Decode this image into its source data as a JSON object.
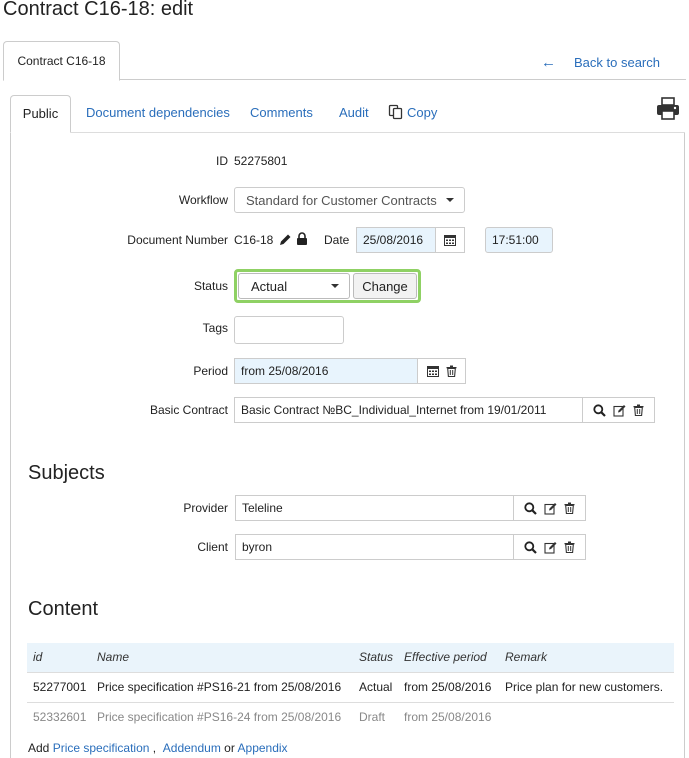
{
  "page_title": "Contract C16-18: edit",
  "outer_tab": "Contract C16-18",
  "back_link": "Back to search",
  "inner_tabs": [
    {
      "label": "Public"
    },
    {
      "label": "Document dependencies"
    },
    {
      "label": "Comments"
    },
    {
      "label": "Audit"
    },
    {
      "label": "Copy"
    }
  ],
  "form": {
    "id_label": "ID",
    "id_value": "52275801",
    "workflow_label": "Workflow",
    "workflow_value": "Standard for Customer Contracts",
    "docnum_label": "Document Number",
    "docnum_value": "C16-18",
    "date_label": "Date",
    "date_value": "25/08/2016",
    "time_value": "17:51:00",
    "status_label": "Status",
    "status_value": "Actual",
    "change_button": "Change",
    "tags_label": "Tags",
    "tags_value": "",
    "period_label": "Period",
    "period_value": "from 25/08/2016",
    "basic_contract_label": "Basic Contract",
    "basic_contract_value": "Basic Contract №BC_Individual_Internet from 19/01/2011"
  },
  "subjects": {
    "heading": "Subjects",
    "provider_label": "Provider",
    "provider_value": "Teleline",
    "client_label": "Client",
    "client_value": "byron"
  },
  "content": {
    "heading": "Content",
    "columns": [
      "id",
      "Name",
      "Status",
      "Effective period",
      "Remark"
    ],
    "rows": [
      {
        "id": "52277001",
        "name": "Price specification #PS16-21 from 25/08/2016",
        "status": "Actual",
        "period": "from 25/08/2016",
        "remark": "Price plan for new customers."
      },
      {
        "id": "52332601",
        "name": "Price specification #PS16-24 from 25/08/2016",
        "status": "Draft",
        "period": "from 25/08/2016",
        "remark": ""
      }
    ],
    "add_prefix": "Add",
    "add_links": [
      "Price specification",
      "Addendum",
      "Appendix"
    ],
    "sep_comma": ",",
    "sep_or": "or"
  },
  "colors": {
    "link": "#2a6ebb",
    "status_highlight": "#8fd164",
    "table_header_bg": "#eaf4fb",
    "date_bg": "#e8f4fd"
  },
  "icons": [
    "back-arrow-icon",
    "copy-icon",
    "print-icon",
    "pencil-icon",
    "lock-icon",
    "calendar-icon",
    "trash-icon",
    "search-icon",
    "edit-icon"
  ]
}
